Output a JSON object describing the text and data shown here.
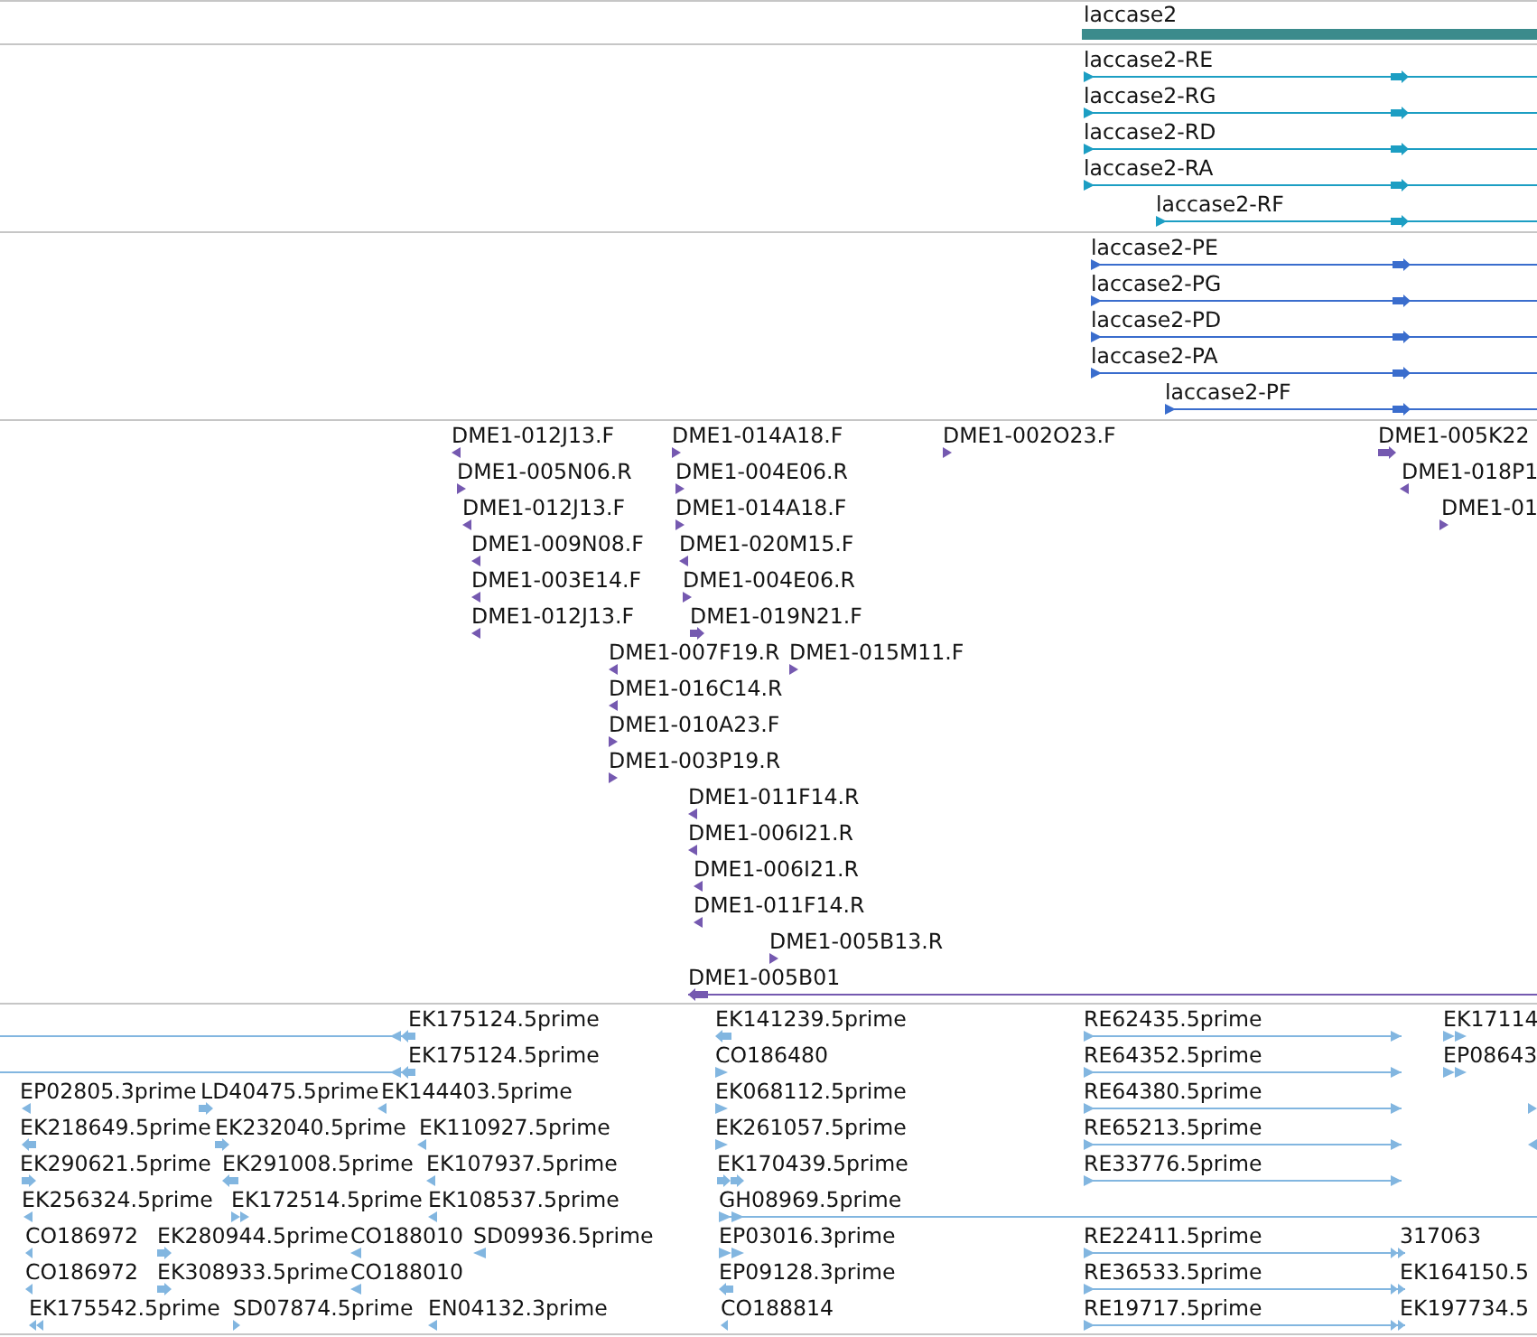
{
  "tracks": [
    {
      "color": "#3b8b8c",
      "features": [
        {
          "kind": "bar",
          "label": "laccase2"
        }
      ]
    },
    {
      "color": "#1c9ec3",
      "features": [
        {
          "kind": "span",
          "forward": true,
          "label": "laccase2-RE"
        },
        {
          "kind": "span",
          "forward": true,
          "label": "laccase2-RG"
        },
        {
          "kind": "span",
          "forward": true,
          "label": "laccase2-RD"
        },
        {
          "kind": "span",
          "forward": true,
          "label": "laccase2-RA"
        },
        {
          "kind": "span",
          "forward": true,
          "label": "laccase2-RF"
        }
      ]
    },
    {
      "color": "#3a6dcd",
      "features": [
        {
          "kind": "span",
          "forward": true,
          "label": "laccase2-PE"
        },
        {
          "kind": "span",
          "forward": true,
          "label": "laccase2-PG"
        },
        {
          "kind": "span",
          "forward": true,
          "label": "laccase2-PD"
        },
        {
          "kind": "span",
          "forward": true,
          "label": "laccase2-PA"
        },
        {
          "kind": "span",
          "forward": true,
          "label": "laccase2-PF"
        }
      ]
    },
    {
      "color": "#7559b0",
      "features": [
        {
          "kind": "arrow",
          "forward": false,
          "label": "DME1-012J13.F"
        },
        {
          "kind": "arrow",
          "forward": true,
          "label": "DME1-014A18.F"
        },
        {
          "kind": "arrow",
          "forward": true,
          "label": "DME1-002O23.F"
        },
        {
          "kind": "arrow",
          "forward": true,
          "label": "DME1-005K22"
        },
        {
          "kind": "arrow",
          "forward": true,
          "label": "DME1-005N06.R"
        },
        {
          "kind": "arrow",
          "forward": true,
          "label": "DME1-004E06.R"
        },
        {
          "kind": "arrow",
          "forward": false,
          "label": "DME1-018P1"
        },
        {
          "kind": "arrow",
          "forward": false,
          "label": "DME1-012J13.F"
        },
        {
          "kind": "arrow",
          "forward": true,
          "label": "DME1-014A18.F"
        },
        {
          "kind": "arrow",
          "forward": true,
          "label": "DME1-01"
        },
        {
          "kind": "arrow",
          "forward": false,
          "label": "DME1-009N08.F"
        },
        {
          "kind": "arrow",
          "forward": false,
          "label": "DME1-020M15.F"
        },
        {
          "kind": "arrow",
          "forward": false,
          "label": "DME1-003E14.F"
        },
        {
          "kind": "arrow",
          "forward": true,
          "label": "DME1-004E06.R"
        },
        {
          "kind": "arrow",
          "forward": false,
          "label": "DME1-012J13.F"
        },
        {
          "kind": "arrow",
          "forward": true,
          "label": "DME1-019N21.F"
        },
        {
          "kind": "arrow",
          "forward": false,
          "label": "DME1-007F19.R"
        },
        {
          "kind": "arrow",
          "forward": true,
          "label": "DME1-015M11.F"
        },
        {
          "kind": "arrow",
          "forward": false,
          "label": "DME1-016C14.R"
        },
        {
          "kind": "arrow",
          "forward": true,
          "label": "DME1-010A23.F"
        },
        {
          "kind": "arrow",
          "forward": true,
          "label": "DME1-003P19.R"
        },
        {
          "kind": "arrow",
          "forward": false,
          "label": "DME1-011F14.R"
        },
        {
          "kind": "arrow",
          "forward": false,
          "label": "DME1-006I21.R"
        },
        {
          "kind": "arrow",
          "forward": false,
          "label": "DME1-006I21.R"
        },
        {
          "kind": "arrow",
          "forward": false,
          "label": "DME1-011F14.R"
        },
        {
          "kind": "arrow",
          "forward": true,
          "label": "DME1-005B13.R"
        },
        {
          "kind": "span",
          "forward": false,
          "label": "DME1-005B01"
        }
      ]
    },
    {
      "color": "#82b6e0",
      "features": [
        {
          "kind": "span",
          "forward": false,
          "label": "EK175124.5prime"
        },
        {
          "kind": "arrow",
          "forward": false,
          "label": "EK141239.5prime"
        },
        {
          "kind": "span",
          "forward": true,
          "label": "RE62435.5prime"
        },
        {
          "kind": "double-arrow",
          "forward": true,
          "label": "EK17114"
        },
        {
          "kind": "span",
          "forward": false,
          "label": "EK175124.5prime"
        },
        {
          "kind": "arrow",
          "forward": true,
          "label": "CO186480"
        },
        {
          "kind": "span",
          "forward": true,
          "label": "RE64352.5prime"
        },
        {
          "kind": "double-arrow",
          "forward": true,
          "label": "EP08643"
        },
        {
          "kind": "arrow",
          "forward": false,
          "label": "EP02805.3prime"
        },
        {
          "kind": "arrow",
          "forward": true,
          "label": "LD40475.5prime"
        },
        {
          "kind": "arrow",
          "forward": false,
          "label": "EK144403.5prime"
        },
        {
          "kind": "arrow",
          "forward": true,
          "label": "EK068112.5prime"
        },
        {
          "kind": "span",
          "forward": true,
          "label": "RE64380.5prime"
        },
        {
          "kind": "arrow",
          "forward": true
        },
        {
          "kind": "arrow",
          "forward": false,
          "label": "EK218649.5prime"
        },
        {
          "kind": "arrow",
          "forward": true,
          "label": "EK232040.5prime"
        },
        {
          "kind": "arrow",
          "forward": false,
          "label": "EK110927.5prime"
        },
        {
          "kind": "arrow",
          "forward": true,
          "label": "EK261057.5prime"
        },
        {
          "kind": "span",
          "forward": true,
          "label": "RE65213.5prime"
        },
        {
          "kind": "arrow",
          "forward": false
        },
        {
          "kind": "arrow",
          "forward": true,
          "label": "EK290621.5prime"
        },
        {
          "kind": "arrow",
          "forward": false,
          "label": "EK291008.5prime"
        },
        {
          "kind": "arrow",
          "forward": false,
          "label": "EK107937.5prime"
        },
        {
          "kind": "double-arrow",
          "forward": true,
          "label": "EK170439.5prime"
        },
        {
          "kind": "span",
          "forward": true,
          "label": "RE33776.5prime"
        },
        {
          "kind": "arrow",
          "forward": false,
          "label": "EK256324.5prime"
        },
        {
          "kind": "double-arrow",
          "forward": true,
          "label": "EK172514.5prime"
        },
        {
          "kind": "arrow",
          "forward": false,
          "label": "EK108537.5prime"
        },
        {
          "kind": "span",
          "forward": true,
          "label": "GH08969.5prime"
        },
        {
          "kind": "arrow",
          "forward": false,
          "label": "CO186972"
        },
        {
          "kind": "arrow",
          "forward": true,
          "label": "EK280944.5prime"
        },
        {
          "kind": "arrow",
          "forward": false,
          "label": "CO188010"
        },
        {
          "kind": "arrow",
          "forward": false,
          "label": "SD09936.5prime"
        },
        {
          "kind": "double-arrow",
          "forward": true,
          "label": "EP03016.3prime"
        },
        {
          "kind": "span",
          "forward": true,
          "label": "RE22411.5prime"
        },
        {
          "label": "317063"
        },
        {
          "kind": "arrow",
          "forward": false,
          "label": "CO186972"
        },
        {
          "kind": "arrow",
          "forward": true,
          "label": "EK308933.5prime"
        },
        {
          "kind": "arrow",
          "forward": false,
          "label": "CO188010"
        },
        {
          "kind": "arrow",
          "forward": false,
          "label": "EP09128.3prime"
        },
        {
          "kind": "span",
          "forward": true,
          "label": "RE36533.5prime"
        },
        {
          "label": "EK164150.5"
        },
        {
          "kind": "double-arrow",
          "forward": false,
          "label": "EK175542.5prime"
        },
        {
          "kind": "arrow",
          "forward": true,
          "label": "SD07874.5prime"
        },
        {
          "kind": "arrow",
          "forward": false,
          "label": "EN04132.3prime"
        },
        {
          "kind": "arrow",
          "forward": false,
          "label": "CO188814"
        },
        {
          "kind": "span",
          "forward": true,
          "label": "RE19717.5prime"
        },
        {
          "label": "EK197734.5"
        }
      ]
    }
  ]
}
